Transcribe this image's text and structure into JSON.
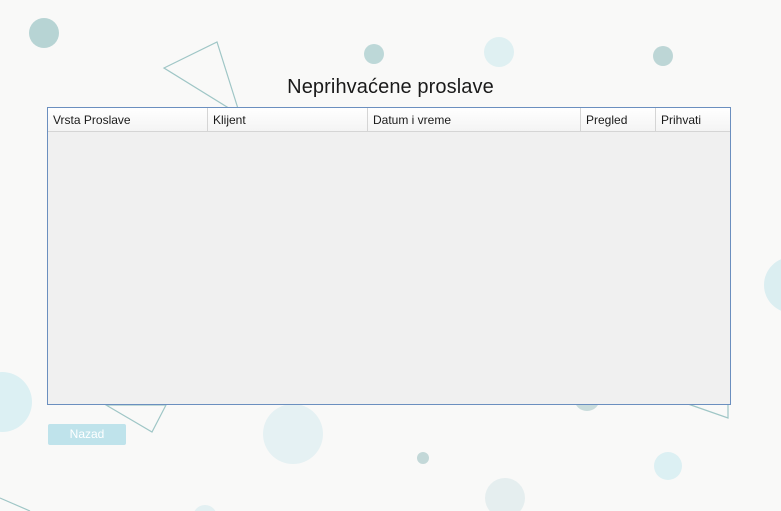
{
  "window": {
    "title": "Neprihvaćene proslave"
  },
  "table": {
    "columns": [
      "Vrsta Proslave",
      "Klijent",
      "Datum i vreme",
      "Pregled",
      "Prihvati"
    ],
    "rows": []
  },
  "buttons": {
    "back_label": "Nazad"
  },
  "colors": {
    "background": "#f9f9f8",
    "grid_border": "#6b8fbf",
    "grid_body": "#f0f0f0",
    "button_bg": "#bfe3eb",
    "decor_teal": "#8fbfbd",
    "decor_light": "#d8eef2"
  }
}
